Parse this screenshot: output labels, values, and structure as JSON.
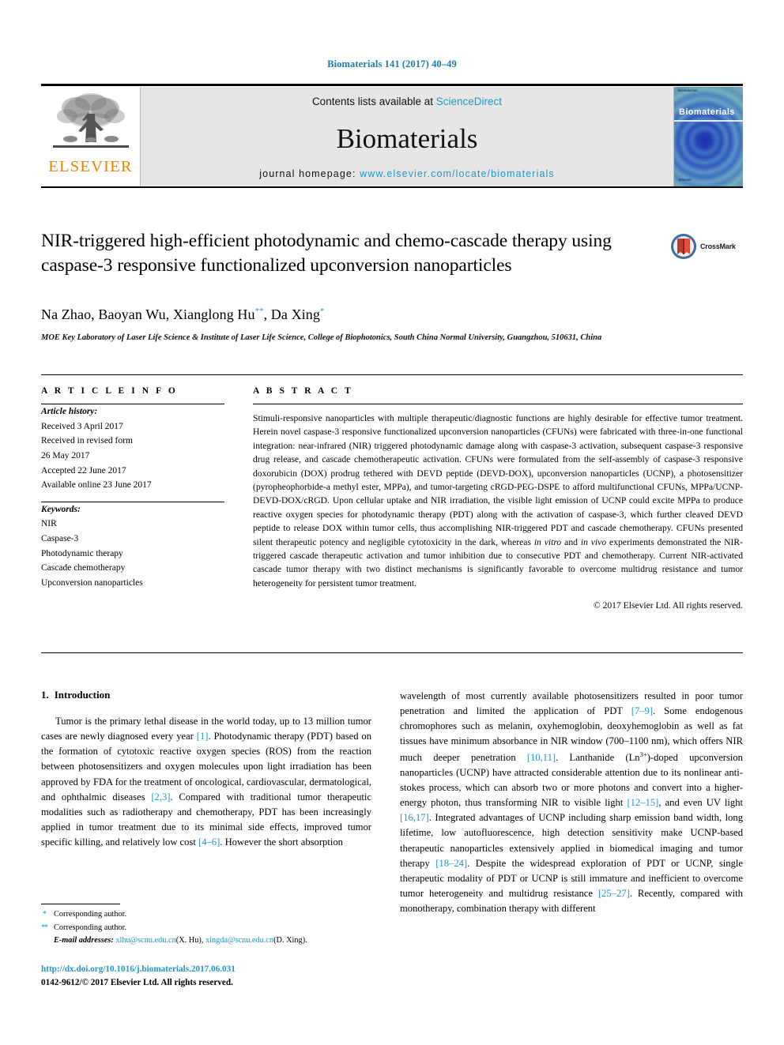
{
  "running_head": "Biomaterials 141 (2017) 40–49",
  "masthead": {
    "contents_prefix": "Contents lists available at ",
    "sciencedirect": "ScienceDirect",
    "journal_name": "Biomaterials",
    "homepage_label": "journal homepage: ",
    "homepage_url": "www.elsevier.com/locate/biomaterials",
    "publisher": "ELSEVIER",
    "cover_title": "Biomaterials",
    "cover_top_text": "Biomaterials",
    "cover_foot_text": "Elsevier"
  },
  "article": {
    "title": "NIR-triggered high-efficient photodynamic and chemo-cascade therapy using caspase-3 responsive functionalized upconversion nanoparticles",
    "authors_html": "Na Zhao, Baoyan Wu, Xianglong Hu<sup>**</sup>, Da Xing<sup>*</sup>",
    "affiliation": "MOE Key Laboratory of Laser Life Science & Institute of Laser Life Science, College of Biophotonics, South China Normal University, Guangzhou, 510631, China",
    "crossmark_label": "CrossMark"
  },
  "article_info": {
    "heading": "A R T I C L E   I N F O",
    "history_label": "Article history:",
    "history": [
      "Received 3 April 2017",
      "Received in revised form",
      "26 May 2017",
      "Accepted 22 June 2017",
      "Available online 23 June 2017"
    ],
    "keywords_label": "Keywords:",
    "keywords": [
      "NIR",
      "Caspase-3",
      "Photodynamic therapy",
      "Cascade chemotherapy",
      "Upconversion nanoparticles"
    ]
  },
  "abstract": {
    "heading": "A B S T R A C T",
    "text_html": "Stimuli-responsive nanoparticles with multiple therapeutic/diagnostic functions are highly desirable for effective tumor treatment. Herein novel caspase-3 responsive functionalized upconversion nanoparticles (CFUNs) were fabricated with three-in-one functional integration: near-infrared (NIR) triggered photodynamic damage along with caspase-3 activation, subsequent caspase-3 responsive drug release, and cascade chemotherapeutic activation. CFUNs were formulated from the self-assembly of caspase-3 responsive doxorubicin (DOX) prodrug tethered with DEVD peptide (DEVD-DOX), upconversion nanoparticles (UCNP), a photosensitizer (pyropheophorbide-a methyl ester, MPPa), and tumor-targeting cRGD-PEG-DSPE to afford multifunctional CFUNs, MPPa/UCNP-DEVD-DOX/cRGD. Upon cellular uptake and NIR irradiation, the visible light emission of UCNP could excite MPPa to produce reactive oxygen species for photodynamic therapy (PDT) along with the activation of caspase-3, which further cleaved DEVD peptide to release DOX within tumor cells, thus accomplishing NIR-triggered PDT and cascade chemotherapy. CFUNs presented silent therapeutic potency and negligible cytotoxicity in the dark, whereas <i>in vitro</i> and <i>in vivo</i> experiments demonstrated the NIR-triggered cascade therapeutic activation and tumor inhibition due to consecutive PDT and chemotherapy. Current NIR-activated cascade tumor therapy with two distinct mechanisms is significantly favorable to overcome multidrug resistance and tumor heterogeneity for persistent tumor treatment.",
    "copyright": "© 2017 Elsevier Ltd. All rights reserved."
  },
  "body": {
    "section_number": "1.",
    "section_title": "Introduction",
    "left_paragraph_html": "Tumor is the primary lethal disease in the world today, up to 13 million tumor cases are newly diagnosed every year <span class=\"ref\">[1]</span>. Photodynamic therapy (PDT) based on the formation of cytotoxic reactive oxygen species (ROS) from the reaction between photosensitizers and oxygen molecules upon light irradiation has been approved by FDA for the treatment of oncological, cardiovascular, dermatological, and ophthalmic diseases <span class=\"ref\">[2,3]</span>. Compared with traditional tumor therapeutic modalities such as radiotherapy and chemotherapy, PDT has been increasingly applied in tumor treatment due to its minimal side effects, improved tumor specific killing, and relatively low cost <span class=\"ref\">[4–6]</span>. However the short absorption",
    "right_paragraph_html": "wavelength of most currently available photosensitizers resulted in poor tumor penetration and limited the application of PDT <span class=\"ref\">[7–9]</span>. Some endogenous chromophores such as melanin, oxyhemoglobin, deoxyhemoglobin as well as fat tissues have minimum absorbance in NIR window (700–1100 nm), which offers NIR much deeper penetration <span class=\"ref\">[10,11]</span>. Lanthanide (Ln<sup>3+</sup>)-doped upconversion nanoparticles (UCNP) have attracted considerable attention due to its nonlinear anti-stokes process, which can absorb two or more photons and convert into a higher-energy photon, thus transforming NIR to visible light <span class=\"ref\">[12–15]</span>, and even UV light <span class=\"ref\">[16,17]</span>. Integrated advantages of UCNP including sharp emission band width, long lifetime, low autofluorescence, high detection sensitivity make UCNP-based therapeutic nanoparticles extensively applied in biomedical imaging and tumor therapy <span class=\"ref\">[18–24]</span>. Despite the widespread exploration of PDT or UCNP, single therapeutic modality of PDT or UCNP is still immature and inefficient to overcome tumor heterogeneity and multidrug resistance <span class=\"ref\">[25–27]</span>. Recently, compared with monotherapy, combination therapy with different"
  },
  "footnotes": {
    "corresponding_1": "Corresponding author.",
    "corresponding_2": "Corresponding author.",
    "email_label": "E-mail addresses:",
    "email_1": "xlhu@scnu.edu.cn",
    "email_1_name": "(X. Hu)",
    "email_2": "xingda@scnu.edu.cn",
    "email_2_name": "(D. Xing)",
    "doi": "http://dx.doi.org/10.1016/j.biomaterials.2017.06.031",
    "issn_line": "0142-9612/© 2017 Elsevier Ltd. All rights reserved."
  },
  "colors": {
    "link_blue": "#2196c4",
    "header_blue": "#1a7ba5",
    "elsevier_orange": "#ef8200",
    "masthead_grey": "#e6e6e6"
  }
}
